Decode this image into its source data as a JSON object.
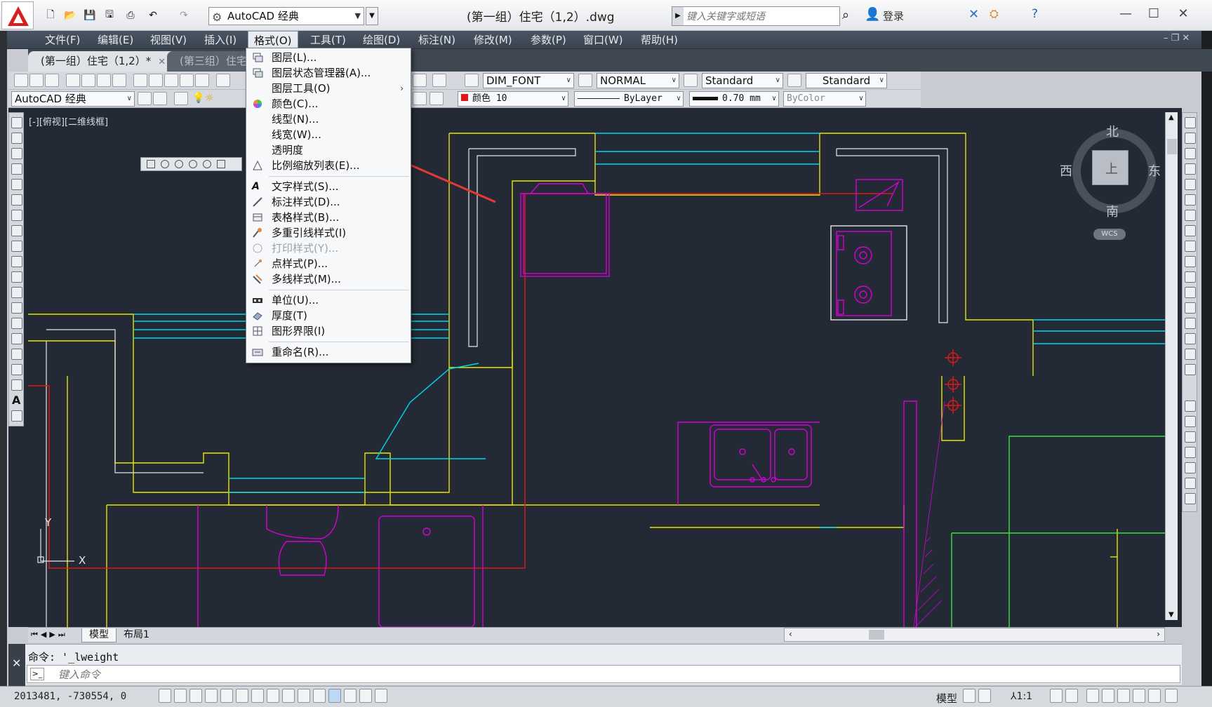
{
  "titlebar": {
    "workspace": "AutoCAD 经典",
    "doc_title": "(第一组）住宅（1,2）.dwg",
    "search_placeholder": "键入关键字或短语",
    "login": "登录"
  },
  "menubar": {
    "items": [
      {
        "label": "文件(F)"
      },
      {
        "label": "编辑(E)"
      },
      {
        "label": "视图(V)"
      },
      {
        "label": "插入(I)"
      },
      {
        "label": "格式(O)",
        "active": true
      },
      {
        "label": "工具(T)"
      },
      {
        "label": "绘图(D)"
      },
      {
        "label": "标注(N)"
      },
      {
        "label": "修改(M)"
      },
      {
        "label": "参数(P)"
      },
      {
        "label": "窗口(W)"
      },
      {
        "label": "帮助(H)"
      }
    ]
  },
  "doc_tabs": [
    {
      "label": "(第一组）住宅（1,2）*",
      "active": true
    },
    {
      "label": "(第三组）住宅",
      "active": false
    }
  ],
  "toolbar": {
    "text_style": "DIM_FONT",
    "dim_style": "NORMAL",
    "table_style": "Standard",
    "mleader_style": "Standard",
    "workspace": "AutoCAD 经典",
    "color": "颜色 10",
    "linetype": "ByLayer",
    "lineweight": "0.70 mm",
    "plotstyle": "ByColor"
  },
  "viewport": {
    "label": "[-][俯视][二维线框]"
  },
  "compass": {
    "north": "北",
    "south": "南",
    "east": "东",
    "west": "西",
    "top": "上",
    "wcs": "WCS"
  },
  "ucs": {
    "x": "X",
    "y": "Y"
  },
  "format_menu": {
    "items": [
      {
        "label": "图层(L)...",
        "icon": "layer-icon"
      },
      {
        "label": "图层状态管理器(A)...",
        "icon": "layer-state-icon"
      },
      {
        "label": "图层工具(O)",
        "icon": "none",
        "submenu": true
      },
      {
        "label": "颜色(C)...",
        "icon": "color-wheel-icon"
      },
      {
        "label": "线型(N)...",
        "icon": "none"
      },
      {
        "label": "线宽(W)...",
        "icon": "none"
      },
      {
        "label": "透明度",
        "icon": "none"
      },
      {
        "label": "比例缩放列表(E)...",
        "icon": "scale-list-icon"
      },
      {
        "label": "文字样式(S)...",
        "icon": "text-style-icon"
      },
      {
        "label": "标注样式(D)...",
        "icon": "dim-style-icon"
      },
      {
        "label": "表格样式(B)...",
        "icon": "table-style-icon"
      },
      {
        "label": "多重引线样式(I)",
        "icon": "mleader-style-icon"
      },
      {
        "label": "打印样式(Y)...",
        "icon": "plot-style-icon",
        "disabled": true
      },
      {
        "label": "点样式(P)...",
        "icon": "point-style-icon"
      },
      {
        "label": "多线样式(M)...",
        "icon": "mline-style-icon"
      },
      {
        "label": "单位(U)...",
        "icon": "units-icon"
      },
      {
        "label": "厚度(T)",
        "icon": "thickness-icon"
      },
      {
        "label": "图形界限(I)",
        "icon": "limits-icon"
      },
      {
        "label": "重命名(R)...",
        "icon": "rename-icon"
      }
    ],
    "submenu_glyph": "›"
  },
  "layout_tabs": {
    "model": "模型",
    "layout1": "布局1"
  },
  "command": {
    "history": "命令: '_lweight",
    "placeholder": "键入命令"
  },
  "status": {
    "coords": "2013481, -730554, 0",
    "model": "模型",
    "scale": "1:1"
  },
  "colors": {
    "canvas": "#242a35",
    "yellow_walls": "#e6e600",
    "cyan_lines": "#00d8e8",
    "magenta_furniture": "#d400d4",
    "red_lines": "#e01818",
    "green_lines": "#3ce03c",
    "annotation_arrow": "#e53935"
  }
}
